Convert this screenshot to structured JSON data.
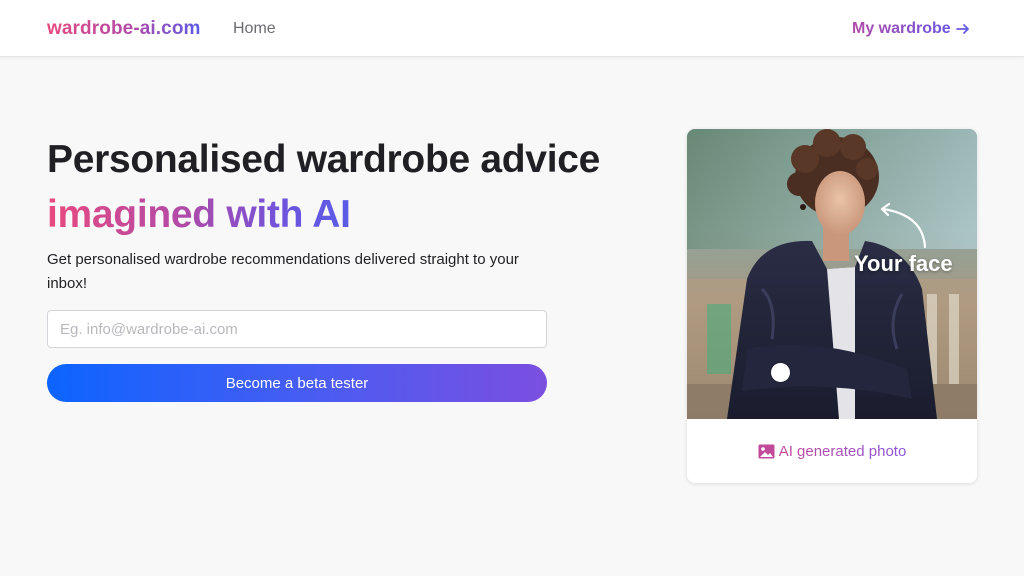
{
  "nav": {
    "brand": "wardrobe-ai.com",
    "home_label": "Home",
    "wardrobe_label": "My wardrobe"
  },
  "hero": {
    "title": "Personalised wardrobe advice",
    "subtitle": "imagined with AI",
    "description": "Get personalised wardrobe recommendations delivered straight to your inbox!",
    "email_placeholder": "Eg. info@wardrobe-ai.com",
    "email_value": "",
    "cta_label": "Become a beta tester"
  },
  "photo_card": {
    "overlay_label": "Your face",
    "caption": "AI generated photo"
  },
  "colors": {
    "accent_pink": "#e84a7f",
    "accent_purple": "#b14aa8",
    "accent_indigo": "#5b5ce6",
    "cta_blue": "#0d64ff",
    "background": "#f8f8f8"
  },
  "icons": {
    "wardrobe_arrow": "arrow-right-icon",
    "caption_icon": "image-icon",
    "overlay_arrow": "curved-arrow-icon"
  }
}
